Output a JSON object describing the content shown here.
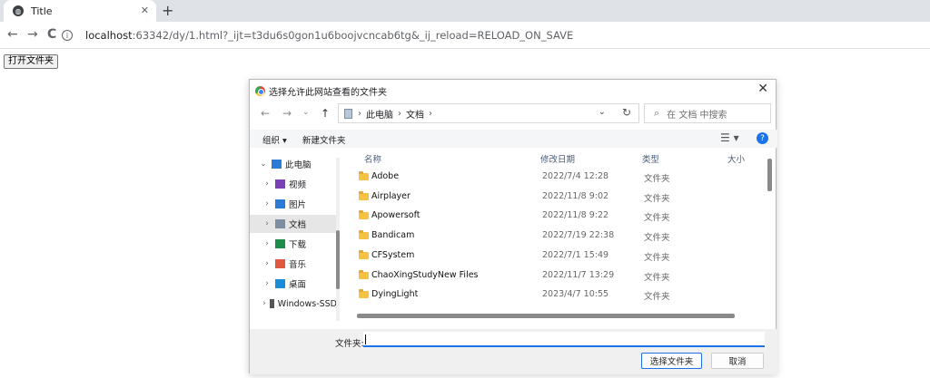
{
  "browser": {
    "tab_title": "Title",
    "tab_close": "✕",
    "new_tab": "+",
    "nav_back": "←",
    "nav_forward": "→",
    "nav_reload": "C",
    "url_host": "localhost",
    "url_rest": ":63342/dy/1.html?_ijt=t3du6s0gon1u6boojvcncab6tg&_ij_reload=RELOAD_ON_SAVE"
  },
  "page": {
    "open_folder_button": "打开文件夹"
  },
  "dialog": {
    "title": "选择允许此网站查看的文件夹",
    "close": "✕",
    "nav": {
      "back": "←",
      "forward": "→",
      "down": "⌄",
      "up": "↑"
    },
    "breadcrumb": [
      "此电脑",
      "文档"
    ],
    "search_placeholder": "在 文档 中搜索",
    "commands": {
      "organize": "组织 ▾",
      "new_folder": "新建文件夹",
      "help": "?"
    },
    "tree": [
      {
        "label": "此电脑",
        "icon": "computer-icon",
        "expanded": true,
        "indent": 0,
        "selected": false,
        "color": "#2b7bd6"
      },
      {
        "label": "视频",
        "icon": "video-icon",
        "indent": 1,
        "selected": false,
        "color": "#7b3fb6"
      },
      {
        "label": "图片",
        "icon": "picture-icon",
        "indent": 1,
        "selected": false,
        "color": "#2b7bd6"
      },
      {
        "label": "文档",
        "icon": "document-icon",
        "indent": 1,
        "selected": true,
        "color": "#7d8ea3"
      },
      {
        "label": "下载",
        "icon": "download-icon",
        "indent": 1,
        "selected": false,
        "color": "#1f8d4a"
      },
      {
        "label": "音乐",
        "icon": "music-icon",
        "indent": 1,
        "selected": false,
        "color": "#e2583e"
      },
      {
        "label": "桌面",
        "icon": "desktop-icon",
        "indent": 1,
        "selected": false,
        "color": "#1a8cd8"
      },
      {
        "label": "Windows-SSD",
        "icon": "drive-icon",
        "indent": 1,
        "selected": false,
        "color": "#555555"
      }
    ],
    "columns": {
      "name": "名称",
      "date": "修改日期",
      "type": "类型",
      "size": "大小"
    },
    "files": [
      {
        "name": "Adobe",
        "date": "2022/7/4 12:28",
        "type": "文件夹"
      },
      {
        "name": "Airplayer",
        "date": "2022/11/8 9:02",
        "type": "文件夹"
      },
      {
        "name": "Apowersoft",
        "date": "2022/11/8 9:22",
        "type": "文件夹"
      },
      {
        "name": "Bandicam",
        "date": "2022/7/19 22:38",
        "type": "文件夹"
      },
      {
        "name": "CFSystem",
        "date": "2022/7/1 15:49",
        "type": "文件夹"
      },
      {
        "name": "ChaoXingStudyNew Files",
        "date": "2022/11/7 13:29",
        "type": "文件夹"
      },
      {
        "name": "DyingLight",
        "date": "2023/4/7 10:55",
        "type": "文件夹"
      }
    ],
    "folder_label": "文件夹:",
    "folder_value": "",
    "select_button": "选择文件夹",
    "cancel_button": "取消"
  }
}
